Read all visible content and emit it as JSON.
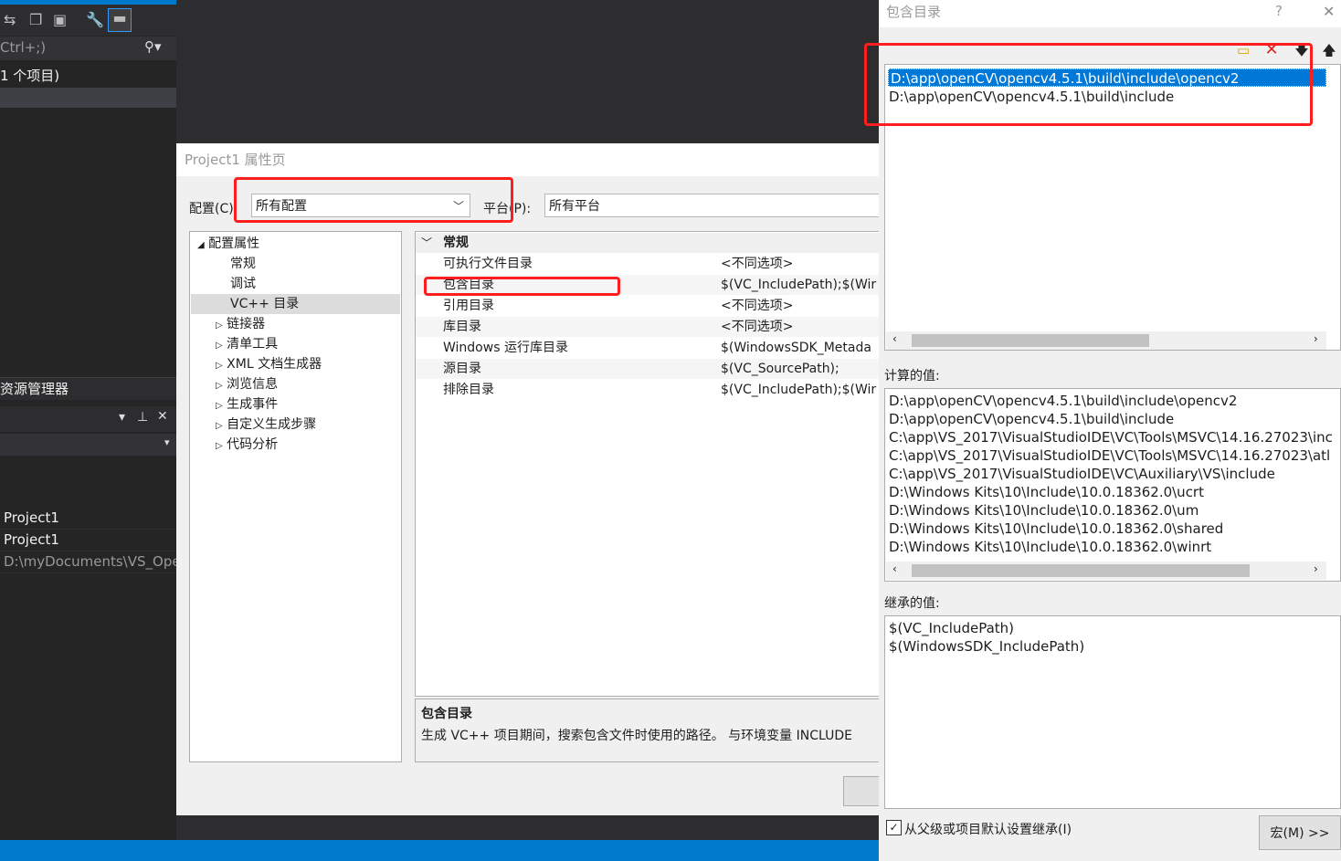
{
  "ide": {
    "search_text": "Ctrl+;)",
    "solution_text": "1 个项目)",
    "explorer_title": "资源管理器",
    "props": [
      "Project1",
      "Project1",
      "D:\\myDocuments\\VS_Ope"
    ]
  },
  "property_dialog": {
    "title": "Project1 属性页",
    "config_label": "配置(C):",
    "config_value": "所有配置",
    "platform_label": "平台(P):",
    "platform_value": "所有平台",
    "tree": {
      "root": "配置属性",
      "items": [
        "常规",
        "调试",
        "VC++ 目录",
        "链接器",
        "清单工具",
        "XML 文档生成器",
        "浏览信息",
        "生成事件",
        "自定义生成步骤",
        "代码分析"
      ]
    },
    "grid": {
      "section": "常规",
      "rows": [
        {
          "key": "可执行文件目录",
          "value": "<不同选项>"
        },
        {
          "key": "包含目录",
          "value": "$(VC_IncludePath);$(Wir"
        },
        {
          "key": "引用目录",
          "value": "<不同选项>"
        },
        {
          "key": "库目录",
          "value": "<不同选项>"
        },
        {
          "key": "Windows 运行库目录",
          "value": "$(WindowsSDK_Metada"
        },
        {
          "key": "源目录",
          "value": "$(VC_SourcePath);"
        },
        {
          "key": "排除目录",
          "value": "$(VC_IncludePath);$(Wir"
        }
      ]
    },
    "description": {
      "title": "包含目录",
      "text": "生成 VC++ 项目期间，搜索包含文件时使用的路径。 与环境变量 INCLUDE"
    }
  },
  "include_dialog": {
    "title": "包含目录",
    "help": "?",
    "close": "✕",
    "entries": [
      "D:\\app\\openCV\\opencv4.5.1\\build\\include\\opencv2",
      "D:\\app\\openCV\\opencv4.5.1\\build\\include"
    ],
    "evaluated_label": "计算的值:",
    "evaluated": [
      "D:\\app\\openCV\\opencv4.5.1\\build\\include\\opencv2",
      "D:\\app\\openCV\\opencv4.5.1\\build\\include",
      "C:\\app\\VS_2017\\VisualStudioIDE\\VC\\Tools\\MSVC\\14.16.27023\\inc",
      "C:\\app\\VS_2017\\VisualStudioIDE\\VC\\Tools\\MSVC\\14.16.27023\\atl",
      "C:\\app\\VS_2017\\VisualStudioIDE\\VC\\Auxiliary\\VS\\include",
      "D:\\Windows Kits\\10\\Include\\10.0.18362.0\\ucrt",
      "D:\\Windows Kits\\10\\Include\\10.0.18362.0\\um",
      "D:\\Windows Kits\\10\\Include\\10.0.18362.0\\shared",
      "D:\\Windows Kits\\10\\Include\\10.0.18362.0\\winrt"
    ],
    "inherited_label": "继承的值:",
    "inherited": [
      "$(VC_IncludePath)",
      "$(WindowsSDK_IncludePath)"
    ],
    "inherit_checkbox": "从父级或项目默认设置继承(I)",
    "inherit_checked": true,
    "macro_button": "宏(M) >>"
  },
  "colors": {
    "highlight": "#ff1e1e",
    "selection": "#0078d7",
    "ide_accent": "#007acc"
  }
}
